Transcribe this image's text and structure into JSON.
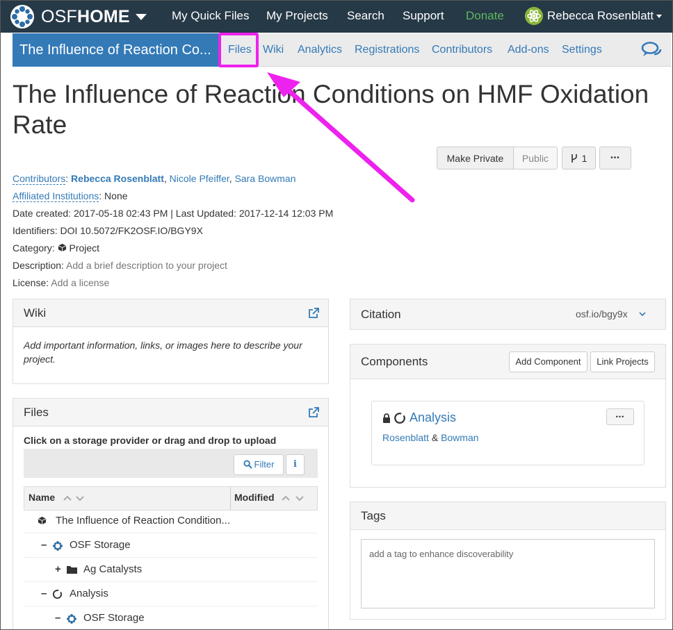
{
  "topnav": {
    "brand_prefix": "OSF",
    "brand_bold": "HOME",
    "items": [
      "My Quick Files",
      "My Projects",
      "Search",
      "Support",
      "Donate"
    ],
    "user_name": "Rebecca Rosenblatt"
  },
  "projbar": {
    "title": "The Influence of Reaction Co...",
    "tabs": [
      "Files",
      "Wiki",
      "Analytics",
      "Registrations",
      "Contributors",
      "Add-ons",
      "Settings"
    ],
    "highlight_color": "#ee22ee"
  },
  "project": {
    "title": "The Influence of Reaction Conditions on HMF Oxidation Rate",
    "buttons": {
      "make_private": "Make Private",
      "public": "Public",
      "forks": "1",
      "more": "•••"
    },
    "contributors_label": "Contributors",
    "contributors": [
      "Rebecca Rosenblatt",
      "Nicole Pfeiffer",
      "Sara Bowman"
    ],
    "affiliated_label": "Affiliated Institutions",
    "affiliated_value": "None",
    "date_line": "Date created: 2017-05-18 02:43 PM | Last Updated: 2017-12-14 12:03 PM",
    "identifiers": "Identifiers: DOI 10.5072/FK2OSF.IO/BGY9X",
    "category_label": "Category:",
    "category_value": "Project",
    "description_label": "Description:",
    "description_value": "Add a brief description to your project",
    "license_label": "License:",
    "license_value": "Add a license"
  },
  "wiki": {
    "title": "Wiki",
    "body": "Add important information, links, or images here to describe your project."
  },
  "files": {
    "title": "Files",
    "instructions": "Click on a storage provider or drag and drop to upload",
    "filter_label": "Filter",
    "col_name": "Name",
    "col_modified": "Modified",
    "rows": [
      {
        "label": "The Influence of Reaction Condition...",
        "expander": "",
        "icon": "cube-icon"
      },
      {
        "label": "OSF Storage",
        "expander": "–",
        "icon": "osf-storage-icon"
      },
      {
        "label": "Ag Catalysts",
        "expander": "+",
        "icon": "folder-icon"
      },
      {
        "label": "Analysis",
        "expander": "–",
        "icon": "component-icon"
      },
      {
        "label": "OSF Storage",
        "expander": "–",
        "icon": "osf-storage-icon"
      }
    ]
  },
  "citation": {
    "title": "Citation",
    "link": "osf.io/bgy9x"
  },
  "components": {
    "title": "Components",
    "add_label": "Add Component",
    "link_label": "Link Projects",
    "item": {
      "name": "Analysis",
      "authors": [
        "Rosenblatt",
        "Bowman"
      ],
      "amp": "&",
      "more": "•••"
    }
  },
  "tags": {
    "title": "Tags",
    "placeholder": "add a tag to enhance discoverability"
  }
}
